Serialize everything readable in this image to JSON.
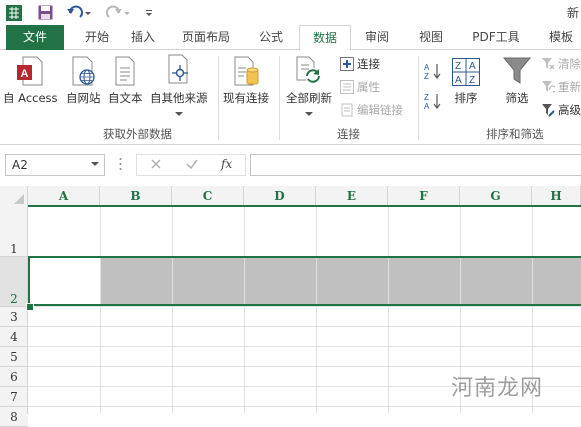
{
  "title": {
    "text": "新"
  },
  "tabs": [
    {
      "label": "文件"
    },
    {
      "label": "开始"
    },
    {
      "label": "插入"
    },
    {
      "label": "页面布局"
    },
    {
      "label": "公式"
    },
    {
      "label": "数据"
    },
    {
      "label": "审阅"
    },
    {
      "label": "视图"
    },
    {
      "label": "PDF工具"
    },
    {
      "label": "模板"
    }
  ],
  "active_tab": "数据",
  "ribbon": {
    "get_external": {
      "group_label": "获取外部数据",
      "from_access": "自 Access",
      "from_web": "自网站",
      "from_text": "自文本",
      "from_other": "自其他来源",
      "existing": "现有连接"
    },
    "connections": {
      "group_label": "连接",
      "refresh_all": "全部刷新",
      "connections": "连接",
      "properties": "属性",
      "edit_links": "编辑链接"
    },
    "sort_filter": {
      "group_label": "排序和筛选",
      "sort": "排序",
      "filter": "筛选",
      "clear": "清除",
      "reapply": "重新",
      "advanced": "高级"
    }
  },
  "formula_bar": {
    "name_box": "A2",
    "fx": "fx",
    "value": ""
  },
  "grid": {
    "columns": [
      "A",
      "B",
      "C",
      "D",
      "E",
      "F",
      "G",
      "H"
    ],
    "rows": [
      "1",
      "2",
      "3",
      "4",
      "5",
      "6",
      "7",
      "8"
    ],
    "selected_row": "2"
  },
  "watermark": "河南龙网",
  "colors": {
    "accent": "#217346",
    "selected_fill": "#c0c0c0"
  }
}
